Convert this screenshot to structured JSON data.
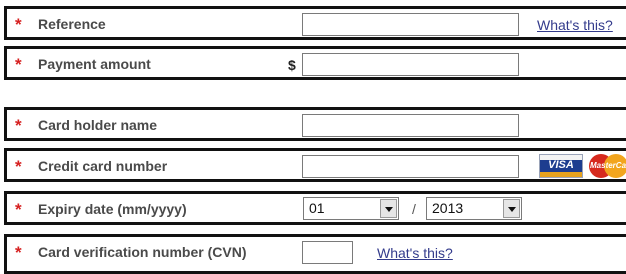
{
  "required_marker": "*",
  "fields": {
    "reference": {
      "label": "Reference",
      "value": "",
      "help_link": "What's this?"
    },
    "payment_amount": {
      "label": "Payment amount",
      "currency_symbol": "$",
      "value": ""
    },
    "card_holder_name": {
      "label": "Card holder name",
      "value": ""
    },
    "credit_card_number": {
      "label": "Credit card number",
      "value": "",
      "accepted_cards": [
        {
          "name": "visa-card-icon",
          "text": "VISA"
        },
        {
          "name": "mastercard-icon",
          "text": "MasterCard"
        }
      ]
    },
    "expiry_date": {
      "label": "Expiry date (mm/yyyy)",
      "month": "01",
      "separator": "/",
      "year": "2013"
    },
    "cvn": {
      "label": "Card verification number (CVN)",
      "value": "",
      "help_link": "What's this?"
    }
  },
  "colors": {
    "required_star": "#d62020",
    "label_text": "#4a4a4a",
    "link": "#333b8c",
    "row_border": "#111111"
  }
}
